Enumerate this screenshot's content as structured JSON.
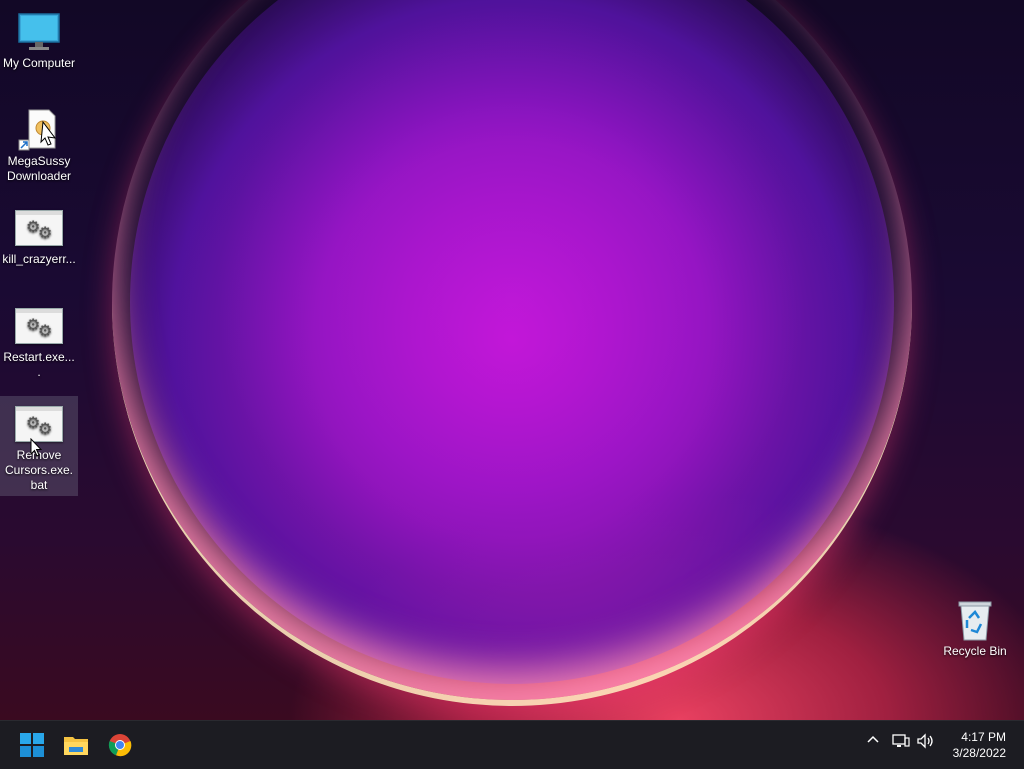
{
  "desktop": {
    "icons": [
      {
        "label": "My Computer",
        "type": "computer"
      },
      {
        "label": "MegaSussy Downloader",
        "type": "shortcut"
      },
      {
        "label": "kill_crazyerr...",
        "type": "batch"
      },
      {
        "label": "Restart.exe....",
        "type": "batch"
      },
      {
        "label": "Remove Cursors.exe.bat",
        "type": "batch"
      }
    ],
    "recycle_bin": {
      "label": "Recycle Bin"
    }
  },
  "taskbar": {
    "pinned": [
      "start-icon",
      "file-explorer-icon",
      "chrome-icon"
    ],
    "tray": {
      "show_hidden_icons": "chevron-up-icon",
      "network": "network-icon",
      "volume": "volume-icon"
    },
    "clock": {
      "time": "4:17 PM",
      "date": "3/28/2022"
    }
  },
  "colors": {
    "taskbar": "#1c1c22",
    "accent": "#0078d4",
    "selection": "#78788c"
  }
}
